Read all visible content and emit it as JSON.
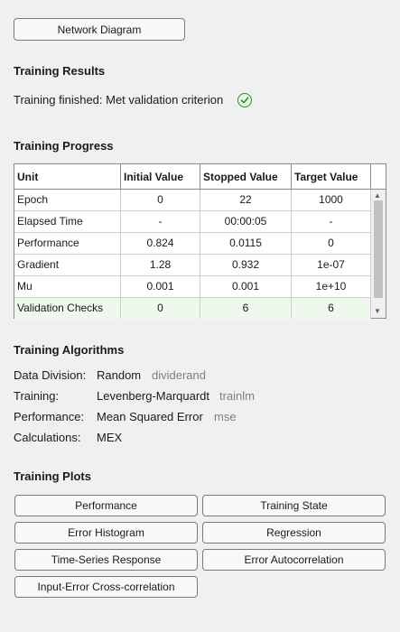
{
  "network_diagram_label": "Network Diagram",
  "results": {
    "heading": "Training Results",
    "status": "Training finished: Met validation criterion",
    "status_icon": "check-circle-icon",
    "status_color": "#2e8b2e"
  },
  "progress": {
    "heading": "Training Progress",
    "columns": [
      "Unit",
      "Initial Value",
      "Stopped Value",
      "Target Value"
    ],
    "rows": [
      [
        "Epoch",
        "0",
        "22",
        "1000"
      ],
      [
        "Elapsed Time",
        "-",
        "00:00:05",
        "-"
      ],
      [
        "Performance",
        "0.824",
        "0.0115",
        "0"
      ],
      [
        "Gradient",
        "1.28",
        "0.932",
        "1e-07"
      ],
      [
        "Mu",
        "0.001",
        "0.001",
        "1e+10"
      ],
      [
        "Validation Checks",
        "0",
        "6",
        "6"
      ]
    ],
    "highlight_color": "#eef8ec"
  },
  "algorithms": {
    "heading": "Training Algorithms",
    "items": [
      {
        "label": "Data Division:",
        "value": "Random",
        "func": "dividerand"
      },
      {
        "label": "Training:",
        "value": "Levenberg-Marquardt",
        "func": "trainlm"
      },
      {
        "label": "Performance:",
        "value": "Mean Squared Error",
        "func": "mse"
      },
      {
        "label": "Calculations:",
        "value": "MEX",
        "func": ""
      }
    ]
  },
  "plots": {
    "heading": "Training Plots",
    "buttons": [
      "Performance",
      "Training State",
      "Error Histogram",
      "Regression",
      "Time-Series Response",
      "Error Autocorrelation",
      "Input-Error Cross-correlation"
    ]
  }
}
